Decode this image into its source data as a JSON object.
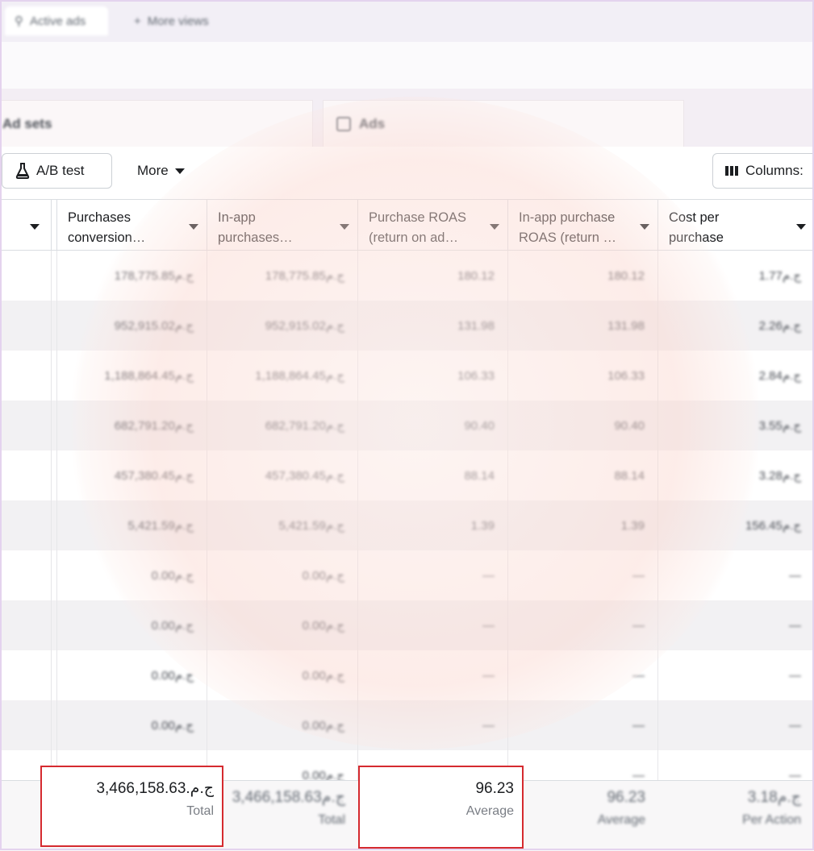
{
  "tabs": {
    "active": "Active ads",
    "more_views": "More views"
  },
  "level_tabs": {
    "ad_sets": "Ad sets",
    "ads": "Ads"
  },
  "toolbar": {
    "ab_test": "A/B test",
    "more": "More",
    "columns": "Columns:"
  },
  "columns": [
    {
      "label": "Purchases\nconversion…"
    },
    {
      "label": "In-app\npurchases…"
    },
    {
      "label": "Purchase ROAS\n(return on ad…"
    },
    {
      "label": "In-app purchase\nROAS (return …"
    },
    {
      "label": "Cost per\npurchase"
    }
  ],
  "rows": [
    {
      "purchases_value": "178,775.85ج.م",
      "inapp_value": "178,775.85ج.م",
      "roas": "180.12",
      "inapp_roas": "180.12",
      "cpp": "1.77ج.م"
    },
    {
      "purchases_value": "952,915.02ج.م",
      "inapp_value": "952,915.02ج.م",
      "roas": "131.98",
      "inapp_roas": "131.98",
      "cpp": "2.26ج.م"
    },
    {
      "purchases_value": "1,188,864.45ج.م",
      "inapp_value": "1,188,864.45ج.م",
      "roas": "106.33",
      "inapp_roas": "106.33",
      "cpp": "2.84ج.م"
    },
    {
      "purchases_value": "682,791.20ج.م",
      "inapp_value": "682,791.20ج.م",
      "roas": "90.40",
      "inapp_roas": "90.40",
      "cpp": "3.55ج.م"
    },
    {
      "purchases_value": "457,380.45ج.م",
      "inapp_value": "457,380.45ج.م",
      "roas": "88.14",
      "inapp_roas": "88.14",
      "cpp": "3.28ج.م"
    },
    {
      "purchases_value": "5,421.59ج.م",
      "inapp_value": "5,421.59ج.م",
      "roas": "1.39",
      "inapp_roas": "1.39",
      "cpp": "156.45ج.م"
    },
    {
      "purchases_value": "0.00ج.م",
      "inapp_value": "0.00ج.م",
      "roas": "—",
      "inapp_roas": "—",
      "cpp": "—"
    },
    {
      "purchases_value": "0.00ج.م",
      "inapp_value": "0.00ج.م",
      "roas": "—",
      "inapp_roas": "—",
      "cpp": "—"
    },
    {
      "purchases_value": "0.00ج.م",
      "inapp_value": "0.00ج.م",
      "roas": "—",
      "inapp_roas": "—",
      "cpp": "—"
    },
    {
      "purchases_value": "0.00ج.م",
      "inapp_value": "0.00ج.م",
      "roas": "—",
      "inapp_roas": "—",
      "cpp": "—"
    },
    {
      "purchases_value": "0.00ج.م",
      "inapp_value": "0.00ج.م",
      "roas": "—",
      "inapp_roas": "—",
      "cpp": "—"
    }
  ],
  "totals": {
    "purchases_value": "ج.م.3,466,158.63",
    "purchases_label": "Total",
    "inapp_value": "3,466,158.63ج.م",
    "inapp_label": "Total",
    "roas_value": "96.23",
    "roas_label": "Average",
    "inapp_roas_value": "96.23",
    "inapp_roas_label": "Average",
    "cpp_value": "3.18ج.م",
    "cpp_label": "Per Action"
  },
  "colors": {
    "highlight": "#d52a2f",
    "border": "#dadde1"
  }
}
